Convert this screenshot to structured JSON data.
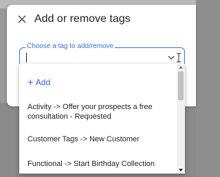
{
  "dialog": {
    "title": "Add or remove tags",
    "icons": {
      "close": "close-icon"
    }
  },
  "tag_field": {
    "label": "Choose a tag to add/remove",
    "value": "",
    "icons": {
      "dropdown": "chevron-down-icon",
      "cursor": "text-cursor-icon"
    }
  },
  "dropdown": {
    "add_label": "Add",
    "items": [
      {
        "label": "Activity -> Offer your prospects a free consultation - Requested"
      },
      {
        "label": "Customer Tags -> New Customer"
      },
      {
        "label": "Functional -> Start Birthday Collection"
      }
    ]
  },
  "colors": {
    "accent": "#3b6fd8",
    "overlay": "#8e8e8e",
    "scroll_thumb": "#c1c1c1"
  }
}
